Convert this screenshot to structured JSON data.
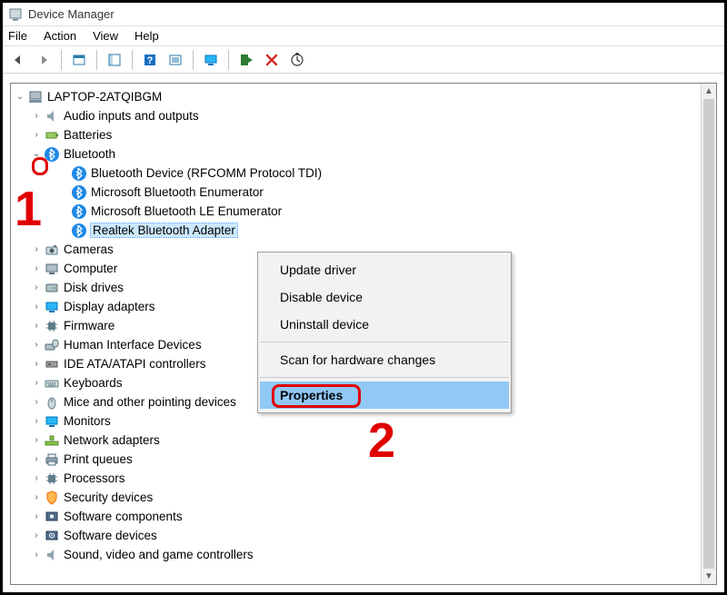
{
  "window": {
    "title": "Device Manager"
  },
  "menubar": {
    "file": "File",
    "action": "Action",
    "view": "View",
    "help": "Help"
  },
  "toolbar_icons": {
    "back": "back-arrow",
    "forward": "forward-arrow",
    "show_hidden": "show-hidden",
    "properties": "properties",
    "help": "help",
    "details": "details-view",
    "monitor": "display-icon",
    "update": "scan-hardware",
    "remove": "remove-device",
    "remote": "remote-connect"
  },
  "tree": {
    "root": "LAPTOP-2ATQIBGM",
    "categories": [
      {
        "label": "Audio inputs and outputs",
        "expanded": false
      },
      {
        "label": "Batteries",
        "expanded": false
      },
      {
        "label": "Bluetooth",
        "expanded": true,
        "children": [
          "Bluetooth Device (RFCOMM Protocol TDI)",
          "Microsoft Bluetooth Enumerator",
          "Microsoft Bluetooth LE Enumerator",
          "Realtek Bluetooth Adapter"
        ],
        "selected_child_index": 3
      },
      {
        "label": "Cameras",
        "expanded": false
      },
      {
        "label": "Computer",
        "expanded": false
      },
      {
        "label": "Disk drives",
        "expanded": false
      },
      {
        "label": "Display adapters",
        "expanded": false
      },
      {
        "label": "Firmware",
        "expanded": false
      },
      {
        "label": "Human Interface Devices",
        "expanded": false
      },
      {
        "label": "IDE ATA/ATAPI controllers",
        "expanded": false
      },
      {
        "label": "Keyboards",
        "expanded": false
      },
      {
        "label": "Mice and other pointing devices",
        "expanded": false
      },
      {
        "label": "Monitors",
        "expanded": false
      },
      {
        "label": "Network adapters",
        "expanded": false
      },
      {
        "label": "Print queues",
        "expanded": false
      },
      {
        "label": "Processors",
        "expanded": false
      },
      {
        "label": "Security devices",
        "expanded": false
      },
      {
        "label": "Software components",
        "expanded": false
      },
      {
        "label": "Software devices",
        "expanded": false
      },
      {
        "label": "Sound, video and game controllers",
        "expanded": false
      }
    ]
  },
  "context_menu": {
    "items": [
      "Update driver",
      "Disable device",
      "Uninstall device",
      "---",
      "Scan for hardware changes",
      "---",
      "Properties"
    ],
    "highlight_index": 6
  },
  "annotations": {
    "one": "1",
    "two": "2"
  }
}
